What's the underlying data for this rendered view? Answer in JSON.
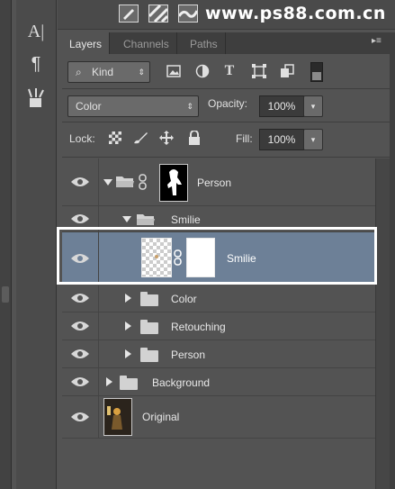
{
  "watermark": "www.ps88.com.cn",
  "tools": {
    "char_glyph": "A|",
    "para_glyph": "¶"
  },
  "tabs": [
    {
      "label": "Layers",
      "active": true
    },
    {
      "label": "Channels",
      "active": false
    },
    {
      "label": "Paths",
      "active": false
    }
  ],
  "filter": {
    "kind_label": "Kind",
    "icons": [
      "image-filter-icon",
      "adjustment-filter-icon",
      "type-filter-icon",
      "shape-filter-icon",
      "smart-object-filter-icon"
    ]
  },
  "blend": {
    "mode": "Color",
    "opacity_label": "Opacity:",
    "opacity_value": "100%"
  },
  "lock": {
    "label": "Lock:",
    "fill_label": "Fill:",
    "fill_value": "100%"
  },
  "layers": [
    {
      "name": "Person",
      "type": "group-with-mask",
      "expanded": true,
      "indent": 0
    },
    {
      "name": "Smilie",
      "type": "group",
      "expanded": true,
      "indent": 1
    },
    {
      "name": "Smilie",
      "type": "layer-with-mask",
      "selected": true,
      "indent": 2
    },
    {
      "name": "Color",
      "type": "group",
      "expanded": false,
      "indent": 1
    },
    {
      "name": "Retouching",
      "type": "group",
      "expanded": false,
      "indent": 1
    },
    {
      "name": "Person",
      "type": "group",
      "expanded": false,
      "indent": 1
    },
    {
      "name": "Background",
      "type": "group",
      "expanded": false,
      "indent": 0
    },
    {
      "name": "Original",
      "type": "layer",
      "indent": 0
    }
  ],
  "colors": {
    "selection_bg": "#6d8097",
    "highlight_box": "#ffffff",
    "panel_bg": "#535353"
  }
}
